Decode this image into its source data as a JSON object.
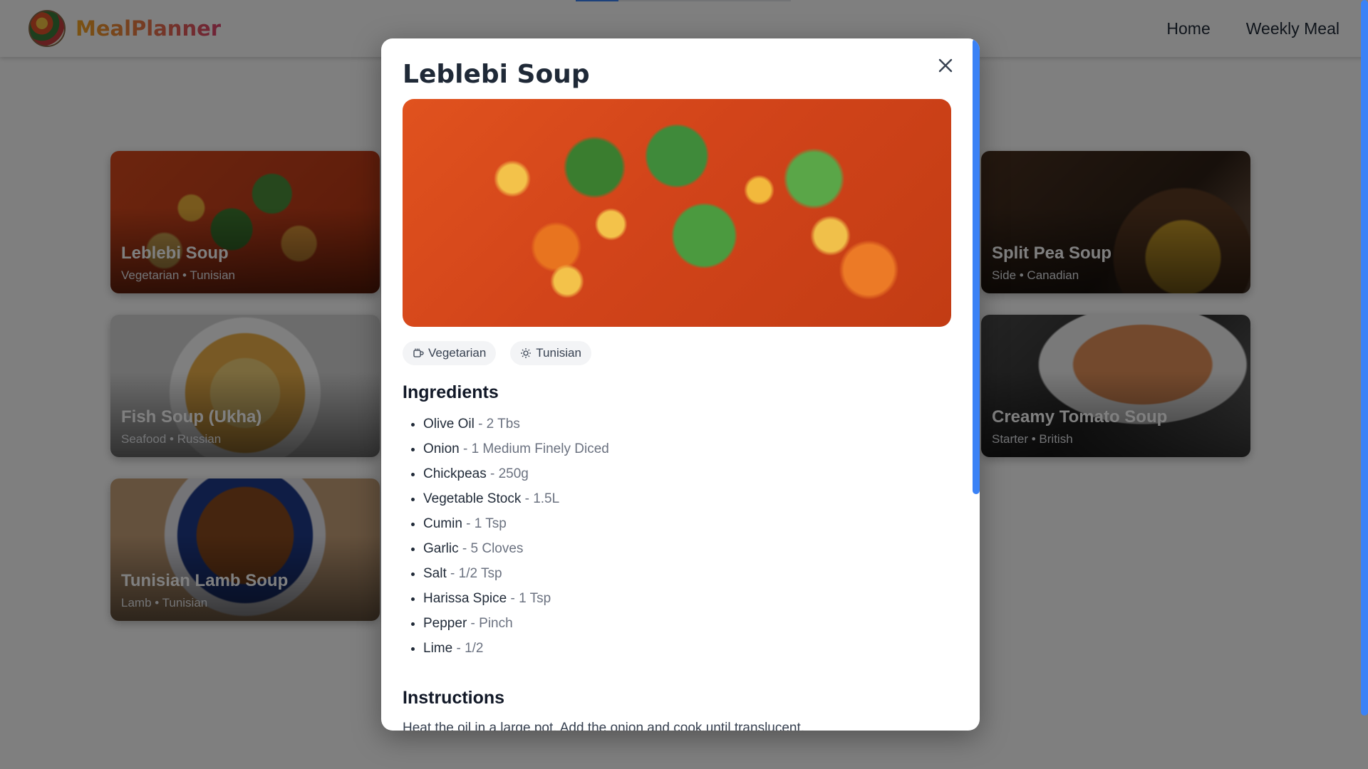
{
  "header": {
    "brand": "MealPlanner",
    "nav": [
      {
        "label": "Home"
      },
      {
        "label": "Weekly Meal"
      }
    ]
  },
  "cards": [
    {
      "title": "Leblebi Soup",
      "meta": "Vegetarian • Tunisian"
    },
    {
      "title": "Fish Soup (Ukha)",
      "meta": "Seafood • Russian"
    },
    {
      "title": "Tunisian Lamb Soup",
      "meta": "Lamb • Tunisian"
    },
    {
      "title": "Split Pea Soup",
      "meta": "Side • Canadian"
    },
    {
      "title": "Creamy Tomato Soup",
      "meta": "Starter • British"
    }
  ],
  "modal": {
    "title": "Leblebi Soup",
    "close_icon": "close-icon",
    "tags": [
      {
        "label": "Vegetarian",
        "icon": "mug-icon"
      },
      {
        "label": "Tunisian",
        "icon": "sun-icon"
      }
    ],
    "ingredients_title": "Ingredients",
    "ingredients": [
      {
        "name": "Olive Oil",
        "qty": " - 2 Tbs"
      },
      {
        "name": "Onion",
        "qty": " - 1 Medium Finely Diced"
      },
      {
        "name": "Chickpeas",
        "qty": " - 250g"
      },
      {
        "name": "Vegetable Stock",
        "qty": " - 1.5L"
      },
      {
        "name": "Cumin",
        "qty": " - 1 Tsp"
      },
      {
        "name": "Garlic",
        "qty": " - 5 Cloves"
      },
      {
        "name": "Salt",
        "qty": " - 1/2 Tsp"
      },
      {
        "name": "Harissa Spice",
        "qty": " - 1 Tsp"
      },
      {
        "name": "Pepper",
        "qty": " - Pinch"
      },
      {
        "name": "Lime",
        "qty": " - 1/2"
      }
    ],
    "instructions_title": "Instructions",
    "instructions_text": "Heat the oil in a large pot. Add the onion and cook until translucent."
  },
  "colors": {
    "accent": "#3b82f6",
    "brand_start": "#f5a623",
    "brand_end": "#e0456f"
  }
}
